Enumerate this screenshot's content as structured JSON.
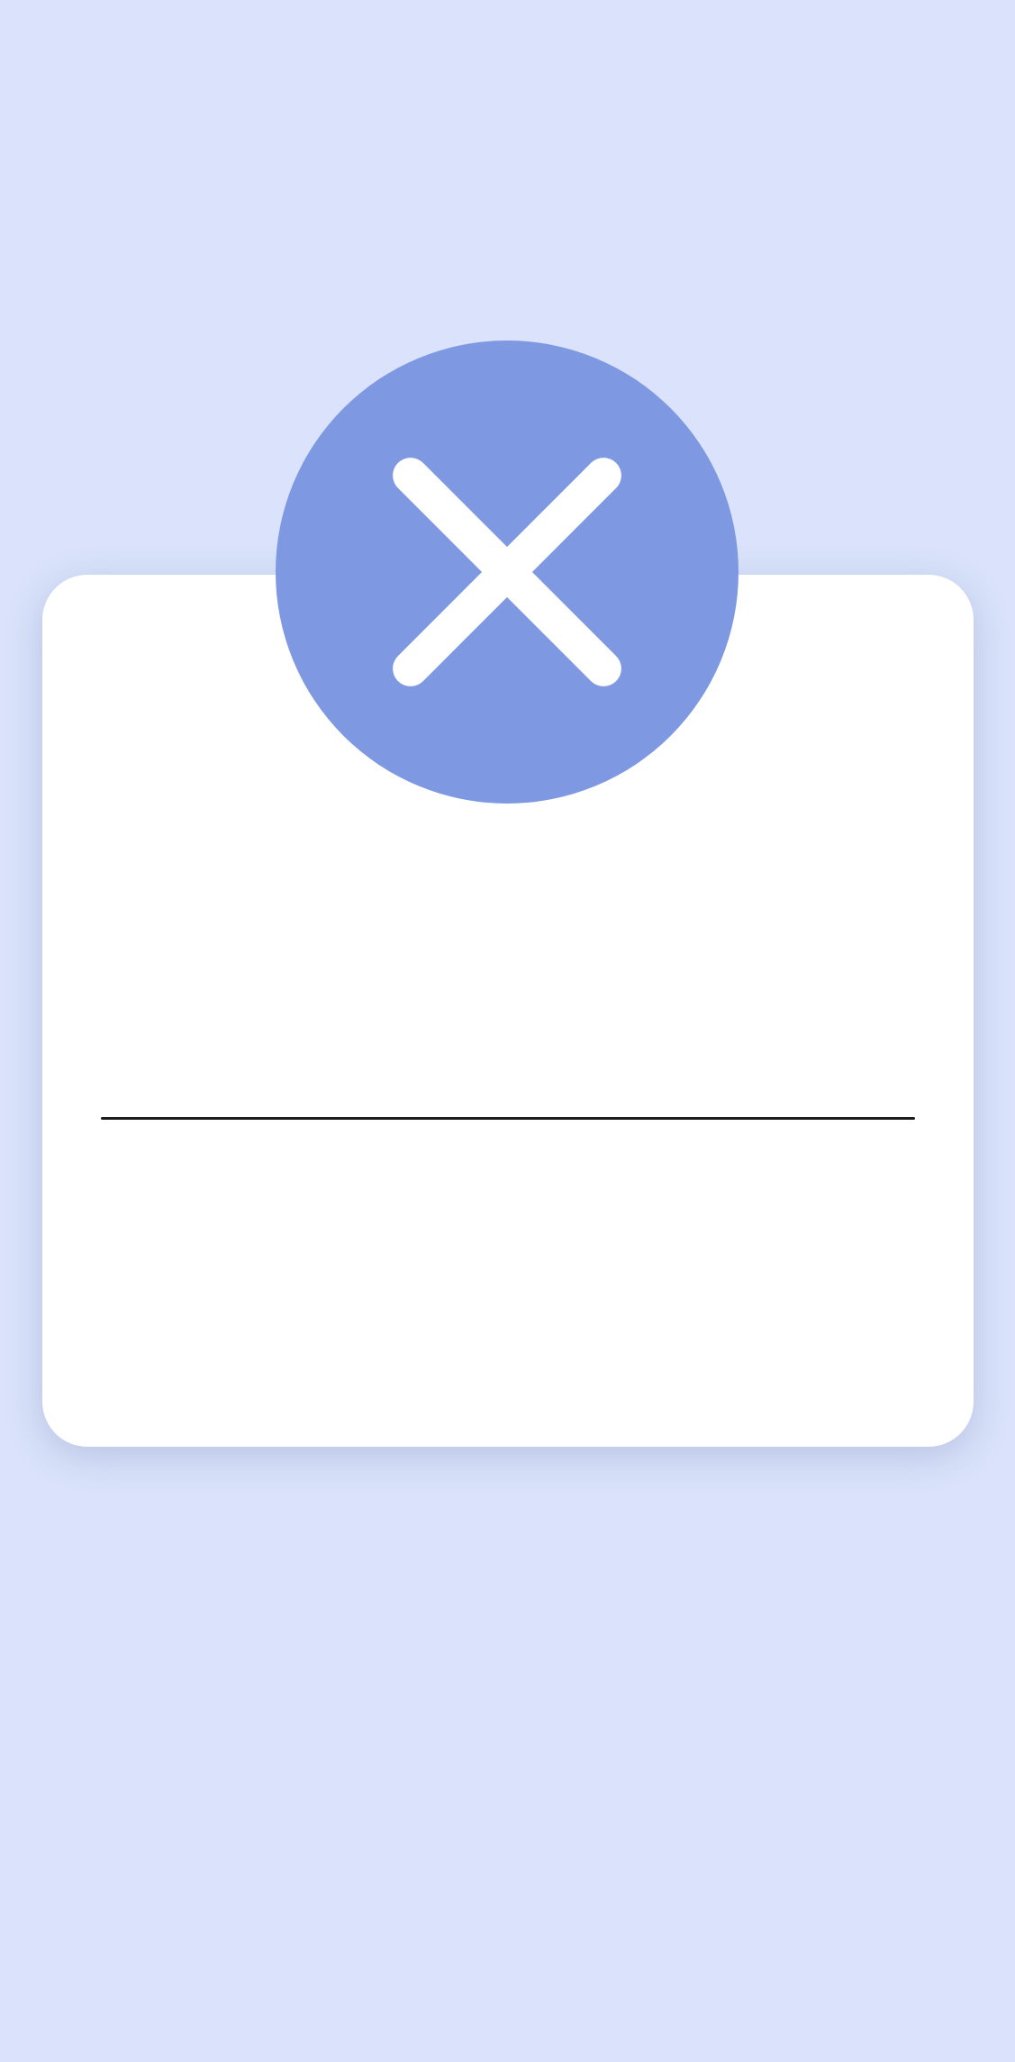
{
  "background_color": "#dae3fb",
  "card": {
    "background_color": "#ffffff",
    "divider_color": "#1c1c1c"
  },
  "close_badge": {
    "icon": "close-icon",
    "background_color": "#7e99e2",
    "icon_color": "#ffffff"
  }
}
